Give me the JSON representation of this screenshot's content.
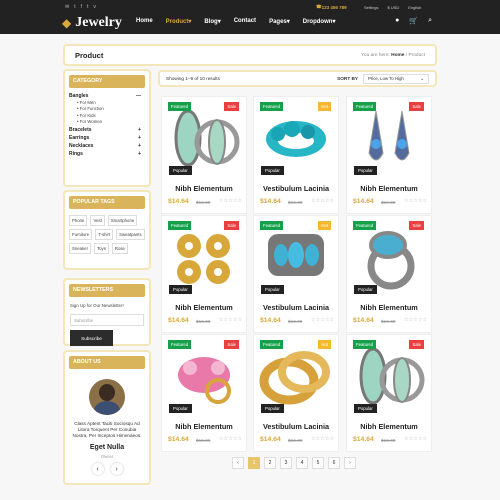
{
  "header": {
    "social_icons": [
      "mail-icon",
      "twitter-icon",
      "facebook-icon",
      "twitter-icon",
      "vimeo-icon"
    ],
    "phone": "123 456 789",
    "settings": "Settings",
    "currency": "$ USD",
    "language": "English",
    "logo": "Jewelry",
    "nav": [
      "Home",
      "Product",
      "Blog",
      "Contact",
      "Pages",
      "Dropdown"
    ],
    "tool_icons": [
      "user-icon",
      "cart-icon",
      "search-icon"
    ]
  },
  "breadcrumb": {
    "title": "Product",
    "prefix": "You are here:",
    "home": "Home",
    "current": "Product"
  },
  "sidebar": {
    "category_title": "CATEGORY",
    "categories": [
      {
        "name": "Bangles",
        "sign": "—",
        "subs": [
          "For Men",
          "For Function",
          "For Kids",
          "For Women"
        ]
      },
      {
        "name": "Bracelets",
        "sign": "+"
      },
      {
        "name": "Earrings",
        "sign": "+"
      },
      {
        "name": "Necklaces",
        "sign": "+"
      },
      {
        "name": "Rings",
        "sign": "+"
      }
    ],
    "tags_title": "POPULAR TAGS",
    "tags": [
      "Phone",
      "Vest",
      "Smartphone",
      "Furniture",
      "T-shirt",
      "Sweatpants",
      "Sneaker",
      "Toys",
      "Rose"
    ],
    "news_title": "NEWSLETTERS",
    "news_text": "Sign Up for Our Newsletter!",
    "news_placeholder": "Subscribe",
    "news_button": "Subscribe",
    "about_title": "ABOUT US",
    "about_quote": "Class Aptent Taciti Sociosqu Ad Litora Torquent Per Conubia Nostra, Per Inceptos Himenaeos.",
    "about_name": "Eget Nulla",
    "about_role": "Owner"
  },
  "sort": {
    "results": "Showing 1–9 of 10 results",
    "label": "SORT BY",
    "selected": "Price, Low To High"
  },
  "products": [
    {
      "name": "Nibh Elementum",
      "price": "$14.64",
      "old": "$16.30",
      "featured": "Featured",
      "flag": "Sale",
      "flag_color": "#ea3f3f",
      "popular": "Popular"
    },
    {
      "name": "Vestibulum Lacinia",
      "price": "$14.64",
      "old": "$16.30",
      "featured": "Featured",
      "flag": "Hot",
      "flag_color": "#f5b82e",
      "popular": "Popular"
    },
    {
      "name": "Nibh Elementum",
      "price": "$14.64",
      "old": "$16.30",
      "featured": "Featured",
      "flag": "Sale",
      "flag_color": "#ea3f3f",
      "popular": "Popular"
    },
    {
      "name": "Nibh Elementum",
      "price": "$14.64",
      "old": "$16.30",
      "featured": "Featured",
      "flag": "Sale",
      "flag_color": "#ea3f3f",
      "popular": "Popular"
    },
    {
      "name": "Vestibulum Lacinia",
      "price": "$14.64",
      "old": "$16.30",
      "featured": "Featured",
      "flag": "Hot",
      "flag_color": "#f5b82e",
      "popular": "Popular"
    },
    {
      "name": "Nibh Elementum",
      "price": "$14.64",
      "old": "$16.30",
      "featured": "Featured",
      "flag": "Sale",
      "flag_color": "#ea3f3f",
      "popular": "Popular"
    },
    {
      "name": "Nibh Elementum",
      "price": "$14.64",
      "old": "$16.30",
      "featured": "Featured",
      "flag": "Sale",
      "flag_color": "#ea3f3f",
      "popular": "Popular"
    },
    {
      "name": "Vestibulum Lacinia",
      "price": "$14.64",
      "old": "$16.30",
      "featured": "Featured",
      "flag": "Hot",
      "flag_color": "#f5b82e",
      "popular": "Popular"
    },
    {
      "name": "Nibh Elementum",
      "price": "$14.64",
      "old": "$16.30",
      "featured": "Featured",
      "flag": "Sale",
      "flag_color": "#ea3f3f",
      "popular": "Popular"
    }
  ],
  "pagination": {
    "prev": "‹",
    "pages": [
      "1",
      "2",
      "3",
      "4",
      "5",
      "6"
    ],
    "next": "›",
    "active": "1"
  }
}
